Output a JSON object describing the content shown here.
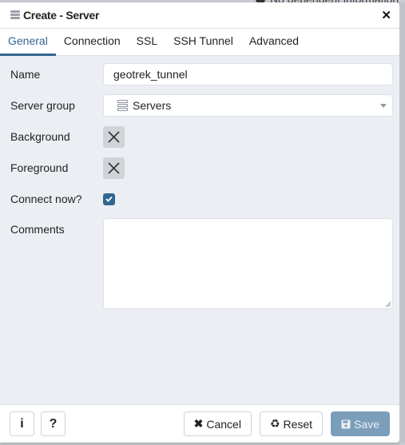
{
  "background": {
    "text": "No dependent information"
  },
  "dialog": {
    "title": "Create - Server",
    "title_icon": "server-icon",
    "close_icon": "close-icon"
  },
  "tabs": [
    {
      "label": "General",
      "active": true
    },
    {
      "label": "Connection",
      "active": false
    },
    {
      "label": "SSL",
      "active": false
    },
    {
      "label": "SSH Tunnel",
      "active": false
    },
    {
      "label": "Advanced",
      "active": false
    }
  ],
  "form": {
    "name": {
      "label": "Name",
      "value": "geotrek_tunnel"
    },
    "server_group": {
      "label": "Server group",
      "value": "Servers",
      "icon": "server-group-icon"
    },
    "background": {
      "label": "Background",
      "icon": "clear-color-icon"
    },
    "foreground": {
      "label": "Foreground",
      "icon": "clear-color-icon"
    },
    "connect_now": {
      "label": "Connect now?",
      "checked": true
    },
    "comments": {
      "label": "Comments",
      "value": ""
    }
  },
  "footer": {
    "info_label": "i",
    "help_label": "?",
    "cancel_label": "Cancel",
    "reset_label": "Reset",
    "save_label": "Save"
  },
  "colors": {
    "accent": "#326690",
    "save_disabled": "#7b9ebb",
    "panel_bg": "#ebeef3"
  }
}
